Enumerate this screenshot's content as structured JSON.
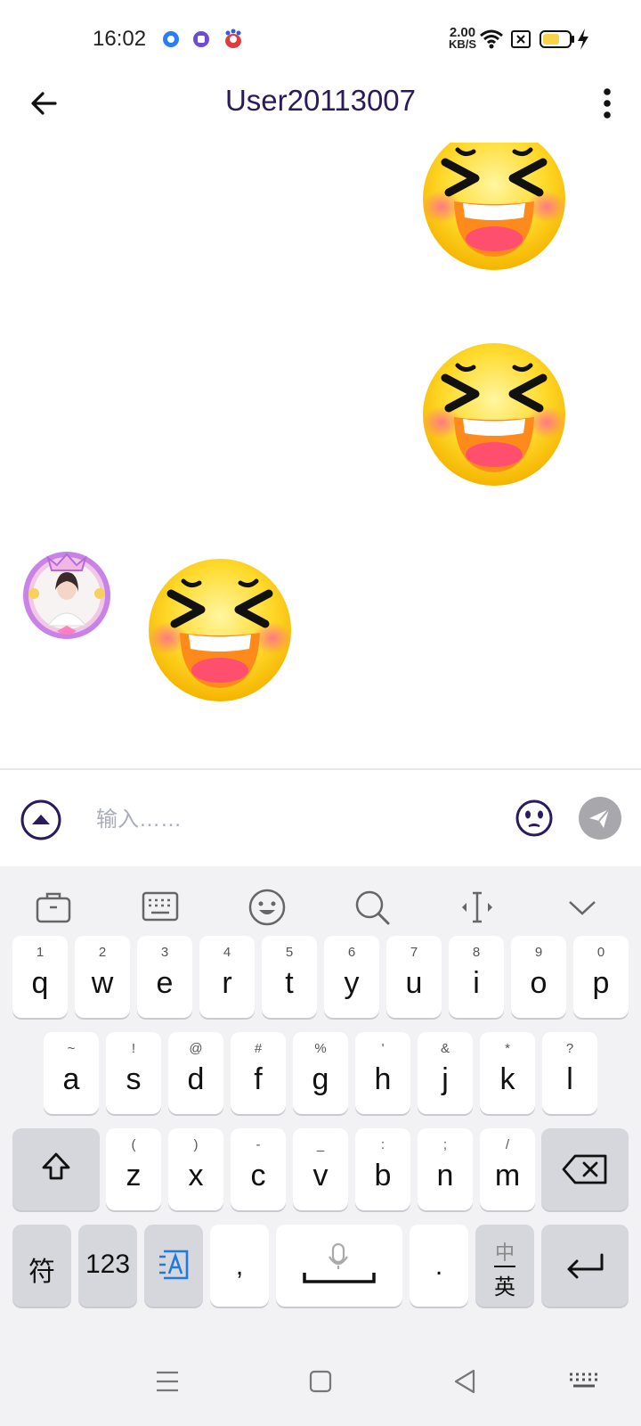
{
  "status_bar": {
    "time": "16:02",
    "net_speed_value": "2.00",
    "net_speed_unit": "KB/S",
    "battery_color": "#f7d24a"
  },
  "header": {
    "title": "User20113007"
  },
  "messages": [
    {
      "side": "right",
      "type": "emoji",
      "icon": "laughing-emoji"
    },
    {
      "side": "right",
      "type": "emoji",
      "icon": "laughing-emoji"
    },
    {
      "side": "left",
      "type": "emoji",
      "icon": "laughing-emoji",
      "avatar": true
    }
  ],
  "input_bar": {
    "placeholder": "输入……",
    "value": ""
  },
  "keyboard": {
    "row1": [
      {
        "sup": "1",
        "key": "q"
      },
      {
        "sup": "2",
        "key": "w"
      },
      {
        "sup": "3",
        "key": "e"
      },
      {
        "sup": "4",
        "key": "r"
      },
      {
        "sup": "5",
        "key": "t"
      },
      {
        "sup": "6",
        "key": "y"
      },
      {
        "sup": "7",
        "key": "u"
      },
      {
        "sup": "8",
        "key": "i"
      },
      {
        "sup": "9",
        "key": "o"
      },
      {
        "sup": "0",
        "key": "p"
      }
    ],
    "row2": [
      {
        "sup": "~",
        "key": "a"
      },
      {
        "sup": "!",
        "key": "s"
      },
      {
        "sup": "@",
        "key": "d"
      },
      {
        "sup": "#",
        "key": "f"
      },
      {
        "sup": "%",
        "key": "g"
      },
      {
        "sup": "'",
        "key": "h"
      },
      {
        "sup": "&",
        "key": "j"
      },
      {
        "sup": "*",
        "key": "k"
      },
      {
        "sup": "?",
        "key": "l"
      }
    ],
    "row3": [
      {
        "sup": "(",
        "key": "z"
      },
      {
        "sup": ")",
        "key": "x"
      },
      {
        "sup": "-",
        "key": "c"
      },
      {
        "sup": "_",
        "key": "v"
      },
      {
        "sup": ":",
        "key": "b"
      },
      {
        "sup": ";",
        "key": "n"
      },
      {
        "sup": "/",
        "key": "m"
      }
    ],
    "symbols_label": "符",
    "numbers_label": "123",
    "comma_label": ",",
    "period_label": ".",
    "lang_top": "中",
    "lang_bottom": "英"
  }
}
